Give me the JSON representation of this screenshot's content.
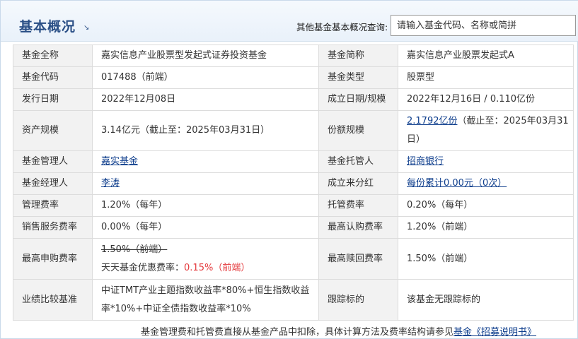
{
  "header": {
    "title": "基本概况",
    "title_arrow": "↘",
    "search_label": "其他基金基本概况查询:",
    "search_placeholder": "请输入基金代码、名称或简拼"
  },
  "rows": {
    "full_name": {
      "label": "基金全称",
      "value": "嘉实信息产业股票型发起式证券投资基金"
    },
    "short_name": {
      "label": "基金简称",
      "value": "嘉实信息产业股票发起式A"
    },
    "code": {
      "label": "基金代码",
      "value": "017488（前端）"
    },
    "type": {
      "label": "基金类型",
      "value": "股票型"
    },
    "issue_date": {
      "label": "发行日期",
      "value": "2022年12月08日"
    },
    "setup": {
      "label": "成立日期/规模",
      "value": "2022年12月16日 / 0.110亿份"
    },
    "asset": {
      "label": "资产规模",
      "value": "3.14亿元（截止至：2025年03月31日）"
    },
    "shares": {
      "label": "份额规模",
      "link": "2.1792亿份",
      "suffix": "（截止至：2025年03月31日）"
    },
    "manager_co": {
      "label": "基金管理人",
      "link": "嘉实基金"
    },
    "custodian": {
      "label": "基金托管人",
      "link": "招商银行"
    },
    "manager": {
      "label": "基金经理人",
      "link": "李涛"
    },
    "dividend": {
      "label": "成立来分红",
      "link": "每份累计0.00元（0次）"
    },
    "mgmt_fee": {
      "label": "管理费率",
      "value": "1.20%（每年）"
    },
    "cust_fee": {
      "label": "托管费率",
      "value": "0.20%（每年）"
    },
    "sales_fee": {
      "label": "销售服务费率",
      "value": "0.00%（每年）"
    },
    "max_sub": {
      "label": "最高认购费率",
      "value": "1.20%（前端）"
    },
    "max_purchase": {
      "label": "最高申购费率",
      "original": "1.50%（前端）",
      "discount_label": "天天基金优惠费率：",
      "discount_value": "0.15%（前端）"
    },
    "max_redeem": {
      "label": "最高赎回费率",
      "value": "1.50%（前端）"
    },
    "benchmark": {
      "label": "业绩比较基准",
      "value": "中证TMT产业主题指数收益率*80%+恒生指数收益率*10%+中证全债指数收益率*10%"
    },
    "tracking": {
      "label": "跟踪标的",
      "value": "该基金无跟踪标的"
    }
  },
  "footer": {
    "text": "基金管理费和托管费直接从基金产品中扣除，具体计算方法及费率结构请参见",
    "link": "基金《招募说明书》"
  }
}
